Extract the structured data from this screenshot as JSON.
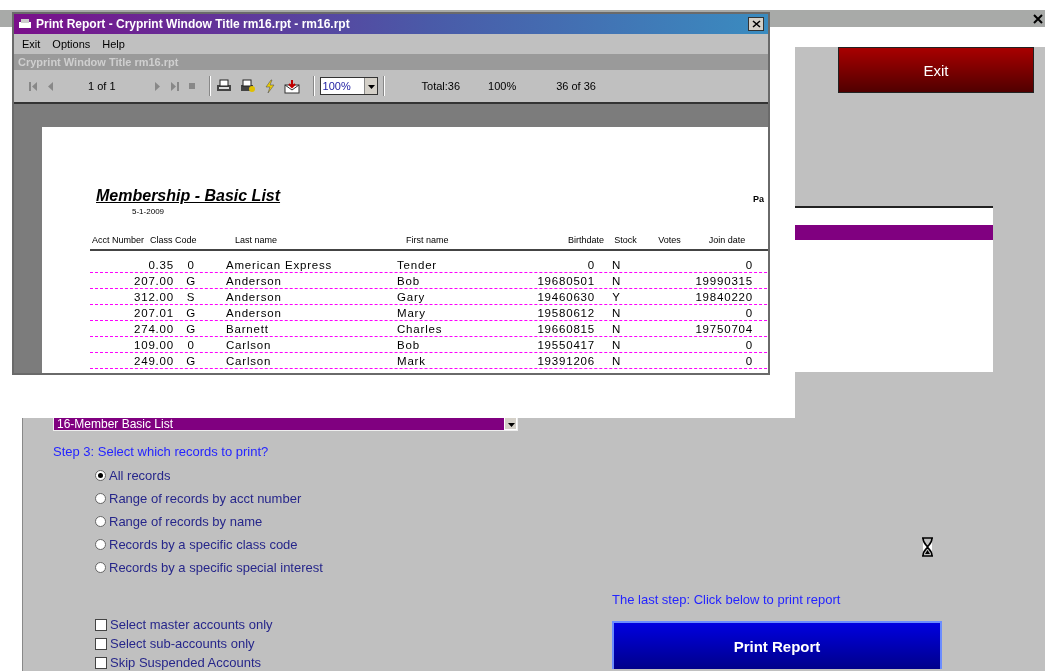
{
  "print_dialog": {
    "title": "Print Report - Cryprint Window Title rm16.rpt - rm16.rpt",
    "menu": [
      "Exit",
      "Options",
      "Help"
    ],
    "caption": "Cryprint Window Title rm16.rpt",
    "toolbar": {
      "page": "1 of 1",
      "zoom": "100%",
      "total": "Total:36",
      "percent": "100%",
      "records": "36 of 36"
    },
    "report": {
      "title": "Membership - Basic List",
      "date": "5-1-2009",
      "page_label": "Pa",
      "columns": [
        "Acct Number",
        "Class Code",
        "Last name",
        "First name",
        "Birthdate",
        "Stock",
        "Votes",
        "Join date"
      ],
      "rows": [
        {
          "acct": "0.35",
          "class_code": "0",
          "last_name": "American Express",
          "first_name": "Tender",
          "birthdate": "0",
          "stock": "N",
          "join_date": "0"
        },
        {
          "acct": "207.00",
          "class_code": "G",
          "last_name": "Anderson",
          "first_name": "Bob",
          "birthdate": "19680501",
          "stock": "N",
          "join_date": "19990315"
        },
        {
          "acct": "312.00",
          "class_code": "S",
          "last_name": "Anderson",
          "first_name": "Gary",
          "birthdate": "19460630",
          "stock": "Y",
          "join_date": "19840220"
        },
        {
          "acct": "207.01",
          "class_code": "G",
          "last_name": "Anderson",
          "first_name": "Mary",
          "birthdate": "19580612",
          "stock": "N",
          "join_date": "0"
        },
        {
          "acct": "274.00",
          "class_code": "G",
          "last_name": "Barnett",
          "first_name": "Charles",
          "birthdate": "19660815",
          "stock": "N",
          "join_date": "19750704"
        },
        {
          "acct": "109.00",
          "class_code": "0",
          "last_name": "Carlson",
          "first_name": "Bob",
          "birthdate": "19550417",
          "stock": "N",
          "join_date": "0"
        },
        {
          "acct": "249.00",
          "class_code": "G",
          "last_name": "Carlson",
          "first_name": "Mark",
          "birthdate": "19391206",
          "stock": "N",
          "join_date": "0"
        }
      ]
    }
  },
  "exit_button": "Exit",
  "report_list": {
    "items": [
      {
        "selected": true
      }
    ]
  },
  "report_combo": "16-Member Basic List",
  "step3": "Step 3: Select which records to print?",
  "record_options": [
    {
      "label": "All records",
      "selected": true
    },
    {
      "label": "Range of records by acct number",
      "selected": false
    },
    {
      "label": "Range of records by name",
      "selected": false
    },
    {
      "label": "Records by a specific class code",
      "selected": false
    },
    {
      "label": "Records by a specific special interest",
      "selected": false
    }
  ],
  "account_filters": [
    {
      "label": "Select master accounts only",
      "checked": false
    },
    {
      "label": "Select sub-accounts only",
      "checked": false
    },
    {
      "label": "Skip Suspended Accounts",
      "checked": false
    }
  ],
  "last_step": "The last step: Click below to print report",
  "print_button": "Print Report"
}
